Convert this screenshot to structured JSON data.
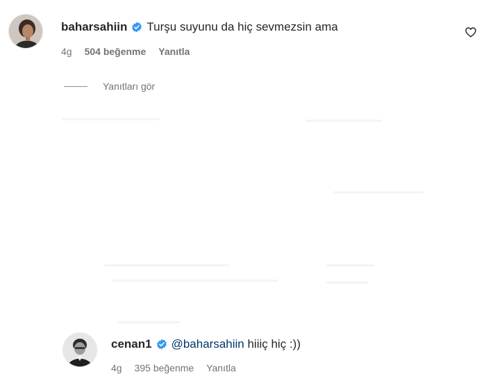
{
  "comments": [
    {
      "username": "baharsahiin",
      "text": "Turşu suyunu da hiç sevmezsin ama",
      "age": "4g",
      "likes": "504 beğenme",
      "reply_label": "Yanıtla"
    },
    {
      "username": "cenan1",
      "mention": "@baharsahiin",
      "text": " hiiiç hiç :))",
      "age": "4g",
      "likes": "395 beğenme",
      "reply_label": "Yanıtla"
    }
  ],
  "view_replies_label": "Yanıtları gör",
  "colors": {
    "verified": "#3897f0",
    "mention": "#00376b",
    "meta": "#737373"
  },
  "icons": [
    "verified-badge-icon",
    "heart-icon"
  ]
}
